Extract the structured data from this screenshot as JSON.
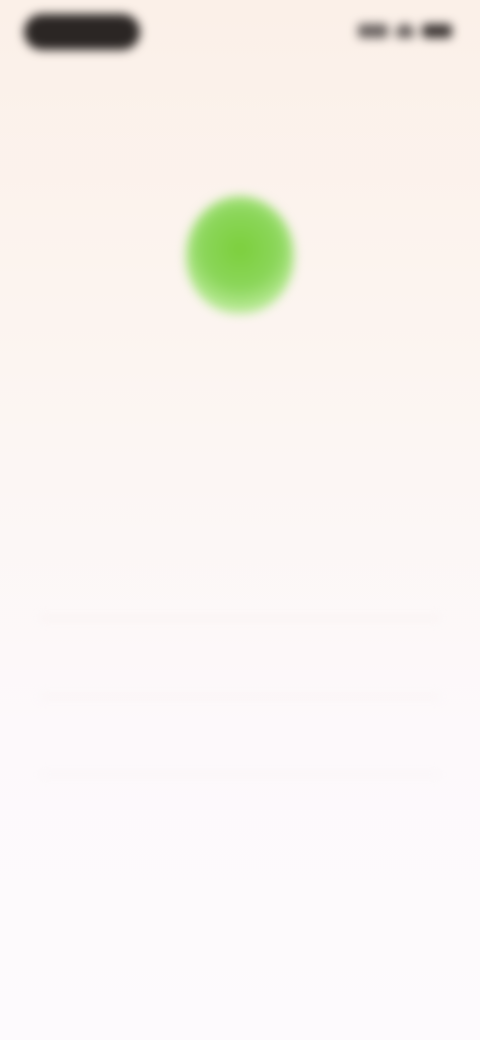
{
  "status_bar": {
    "time": "",
    "signal_icon": "signal-icon",
    "wifi_icon": "wifi-icon",
    "battery_icon": "battery-icon"
  },
  "hero": {
    "icon": "shield-icon",
    "icon_color": "#7ccf3c",
    "headline": "",
    "subtext": ""
  },
  "options": [
    {
      "label": ""
    },
    {
      "label": ""
    },
    {
      "label": ""
    }
  ],
  "colors": {
    "background_top": "#fbf0e8",
    "background_bottom": "#fdfafd",
    "accent": "#7ccf3c"
  }
}
